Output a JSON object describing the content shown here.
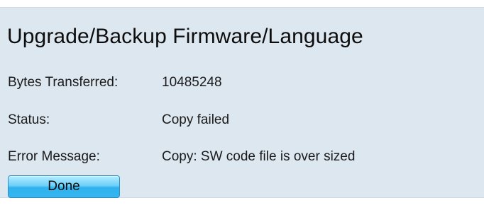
{
  "page_title": "Upgrade/Backup Firmware/Language",
  "rows": [
    {
      "label": "Bytes Transferred:",
      "value": "10485248"
    },
    {
      "label": "Status:",
      "value": "Copy failed"
    },
    {
      "label": "Error Message:",
      "value": "Copy: SW code file is over sized"
    }
  ],
  "buttons": {
    "done_label": "Done"
  },
  "colors": {
    "panel_background": "#dde7f0",
    "button_accent": "#34b6ef"
  }
}
